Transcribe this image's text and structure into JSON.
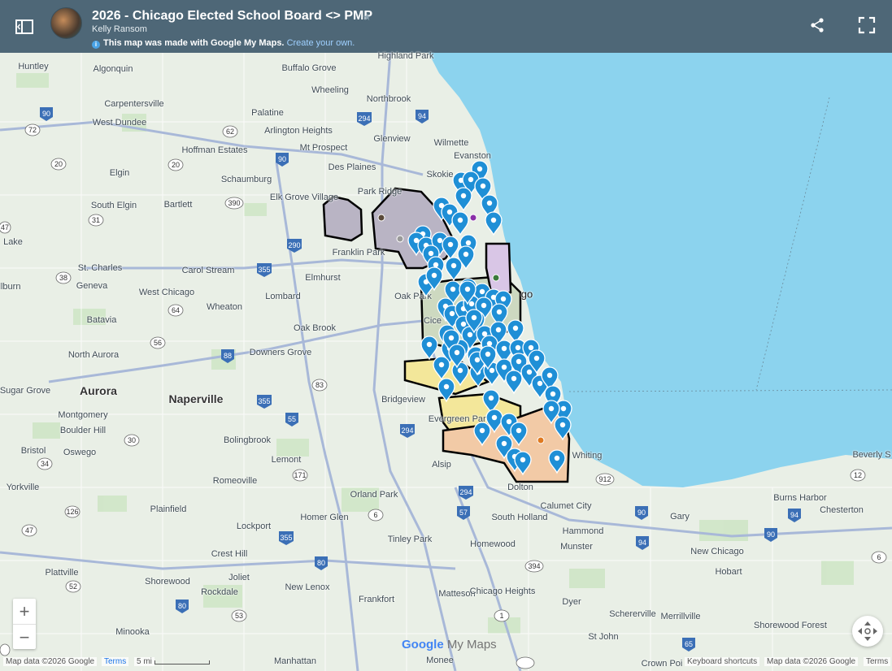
{
  "header": {
    "title": "2026 - Chicago Elected School Board <> PMP",
    "author": "Kelly Ransom",
    "notice_bold": "This map was made with Google My Maps.",
    "notice_link": "Create your own."
  },
  "colors": {
    "header_bg": "#4e6777",
    "marker": "#1f8fd6",
    "water": "#8cd3ee",
    "land": "#e9efe6"
  },
  "icons": {
    "toggle": "sidebar-toggle-icon",
    "share": "share-icon",
    "fullscreen": "fullscreen-icon",
    "star": "star-icon",
    "info": "info-icon"
  },
  "map": {
    "place_labels": [
      "Highland Park",
      "Huntley",
      "Algonquin",
      "Buffalo Grove",
      "Wheeling",
      "Northbrook",
      "Carpentersville",
      "Palatine",
      "West Dundee",
      "Arlington Heights",
      "Glenview",
      "Hoffman Estates",
      "Mt Prospect",
      "Wilmette",
      "Evanston",
      "Elgin",
      "Schaumburg",
      "Des Plaines",
      "Skokie",
      "Park Ridge",
      "South Elgin",
      "Bartlett",
      "Elk Grove Village",
      "Lake",
      "Franklin Park",
      "St. Charles",
      "Carol Stream",
      "Elmhurst",
      "Geneva",
      "West Chicago",
      "Lombard",
      "Oak Park",
      "llburn",
      "Wheaton",
      "Batavia",
      "Oak Brook",
      "Cice",
      "North Aurora",
      "Downers Grove",
      "Sugar Grove",
      "Aurora",
      "Naperville",
      "Bridgeview",
      "Montgomery",
      "Boulder Hill",
      "Evergreen Park",
      "Bolingbrook",
      "Bristol",
      "Oswego",
      "Lemont",
      "Alsip",
      "Whiting",
      "Dolton",
      "Beverly S",
      "Yorkville",
      "Romeoville",
      "Orland Park",
      "Burns Harbor",
      "Chesterton",
      "Calumet City",
      "Plainfield",
      "Homer Glen",
      "South Holland",
      "Gary",
      "Lockport",
      "Hammond",
      "Tinley Park",
      "Homewood",
      "Munster",
      "Crest Hill",
      "New Chicago",
      "Plattville",
      "Joliet",
      "Hobart",
      "Shorewood",
      "New Lenox",
      "Rockdale",
      "Frankfort",
      "Matteson",
      "Chicago Heights",
      "Dyer",
      "Schererville",
      "Merrillville",
      "Shorewood Forest",
      "Minooka",
      "St John",
      "Manhattan",
      "Monee",
      "Crown Poi",
      "go"
    ],
    "highway_shields": [
      "90",
      "94",
      "294",
      "62",
      "72",
      "20",
      "90",
      "390",
      "290",
      "355",
      "31",
      "47",
      "38",
      "56",
      "64",
      "83",
      "88",
      "355",
      "55",
      "34",
      "30",
      "71",
      "294",
      "57",
      "6",
      "90",
      "94",
      "80",
      "80",
      "52",
      "53",
      "1",
      "394",
      "394",
      "912",
      "20",
      "12",
      "6",
      "65",
      "47",
      "126",
      "90",
      "294",
      "55"
    ]
  },
  "controls": {
    "zoom_in": "+",
    "zoom_out": "−",
    "logo_google": "Google",
    "logo_mymaps": "My Maps"
  },
  "footer": {
    "map_data_left": "Map data ©2026 Google",
    "terms_left": "Terms",
    "scale": "5 mi",
    "shortcuts": "Keyboard shortcuts",
    "map_data_right": "Map data ©2026 Google",
    "terms_right": "Terms"
  }
}
